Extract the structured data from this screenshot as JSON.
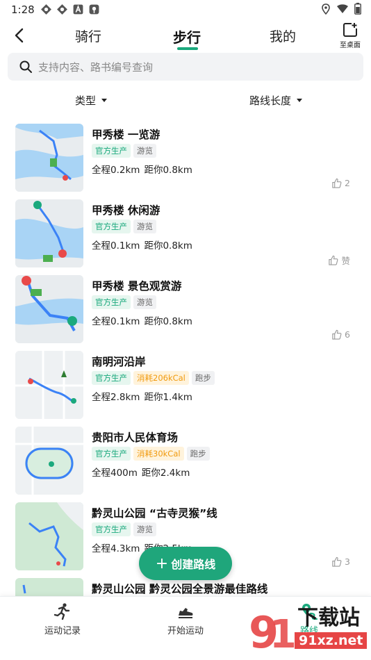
{
  "status_bar": {
    "time": "1:28"
  },
  "topnav": {
    "tabs": [
      {
        "label": "骑行",
        "active": false
      },
      {
        "label": "步行",
        "active": true
      },
      {
        "label": "我的",
        "active": false
      }
    ],
    "desktop_label": "至桌面"
  },
  "search": {
    "placeholder": "支持内容、路书编号查询"
  },
  "filters": {
    "type_label": "类型",
    "length_label": "路线长度"
  },
  "routes": [
    {
      "title": "甲秀楼 一览游",
      "tags": [
        {
          "text": "官方生产",
          "kind": "official"
        },
        {
          "text": "游览",
          "kind": "plain"
        }
      ],
      "distance": "全程0.2km",
      "away": "距你0.8km",
      "likes": "2"
    },
    {
      "title": "甲秀楼 休闲游",
      "tags": [
        {
          "text": "官方生产",
          "kind": "official"
        },
        {
          "text": "游览",
          "kind": "plain"
        }
      ],
      "distance": "全程0.1km",
      "away": "距你0.8km",
      "likes": "赞"
    },
    {
      "title": "甲秀楼 景色观赏游",
      "tags": [
        {
          "text": "官方生产",
          "kind": "official"
        },
        {
          "text": "游览",
          "kind": "plain"
        }
      ],
      "distance": "全程0.1km",
      "away": "距你0.8km",
      "likes": "6"
    },
    {
      "title": "南明河沿岸",
      "tags": [
        {
          "text": "官方生产",
          "kind": "official"
        },
        {
          "text": "消耗206kCal",
          "kind": "kcal"
        },
        {
          "text": "跑步",
          "kind": "plain"
        }
      ],
      "distance": "全程2.8km",
      "away": "距你1.4km",
      "likes": ""
    },
    {
      "title": "贵阳市人民体育场",
      "tags": [
        {
          "text": "官方生产",
          "kind": "official"
        },
        {
          "text": "消耗30kCal",
          "kind": "kcal"
        },
        {
          "text": "跑步",
          "kind": "plain"
        }
      ],
      "distance": "全程400m",
      "away": "距你2.4km",
      "likes": ""
    },
    {
      "title": "黔灵山公园 “古寺灵猴”线",
      "tags": [
        {
          "text": "官方生产",
          "kind": "official"
        },
        {
          "text": "游览",
          "kind": "plain"
        }
      ],
      "distance": "全程4.3km",
      "away": "距你2.5km",
      "likes": "3"
    },
    {
      "title": "黔灵山公园 黔灵公园全景游最佳路线",
      "tags": [],
      "distance": "",
      "away": "",
      "likes": ""
    }
  ],
  "fab": {
    "label": "创建路线"
  },
  "bottom_nav": [
    {
      "label": "运动记录",
      "active": false
    },
    {
      "label": "开始运动",
      "active": false
    },
    {
      "label": "路线",
      "active": true
    }
  ],
  "watermark": {
    "text": "下载站",
    "domain": "91xz.net"
  },
  "colors": {
    "accent": "#1ba97d",
    "kcal": "#f19a0e"
  }
}
